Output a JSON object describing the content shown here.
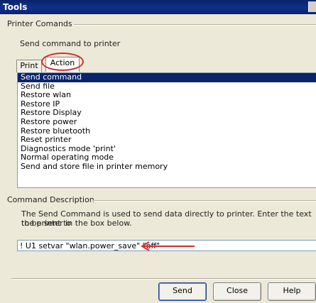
{
  "window": {
    "title": "Tools"
  },
  "printer_commands": {
    "label": "Printer Comands",
    "instruction": "Send command to printer",
    "tabs": [
      {
        "label": "Print",
        "active": false
      },
      {
        "label": "Action",
        "active": true
      }
    ],
    "actions": [
      {
        "label": "Send command",
        "selected": true
      },
      {
        "label": "Send file"
      },
      {
        "label": "Restore wlan"
      },
      {
        "label": "Restore IP"
      },
      {
        "label": "Restore Display"
      },
      {
        "label": "Restore power"
      },
      {
        "label": "Restore bluetooth"
      },
      {
        "label": "Reset printer"
      },
      {
        "label": "Diagnostics mode 'print'"
      },
      {
        "label": "Normal operating mode"
      },
      {
        "label": "Send and store file in printer memory"
      }
    ]
  },
  "command_description": {
    "label": "Command Description",
    "text_line1": "The Send Command is used to send data directly to printer. Enter the text to be sent to",
    "text_line2": "the printer in the box below."
  },
  "command_input": {
    "value": "! U1 setvar \"wlan.power_save\" \"off\""
  },
  "buttons": {
    "send": "Send",
    "close": "Close",
    "help": "Help"
  },
  "colors": {
    "selection": "#0a246a",
    "annotation": "#d32f2f",
    "titlebar": "#0a246a"
  }
}
